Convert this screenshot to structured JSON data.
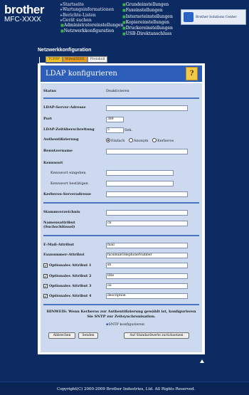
{
  "brand": "brother",
  "model": "MFC-XXXX",
  "nav": {
    "col1": [
      "Startseite",
      "Wartungsinformationen",
      "Berichte-Listen",
      "Gerät suchen",
      "Administratoreinstellungen",
      "Netzwerkkonfiguration"
    ],
    "col2": [
      "Grundeinstellungen",
      "Faxeinstellungen",
      "Interneteinstellungen",
      "Kopiereinstellungen",
      "Druckereinstellungen",
      "USB-Direktanschluss"
    ]
  },
  "solutions_label": "Brother Solutions Center",
  "section_title": "Netzwerkkonfiguration",
  "tabs": [
    "TCP/IP",
    "Wired/IEEE",
    "Protokoll"
  ],
  "panel_title": "LDAP konfigurieren",
  "help_icon": "?",
  "status": {
    "label": "Status",
    "value": "Deaktivieren"
  },
  "fields": {
    "server": {
      "label": "LDAP-Server-Adresse",
      "value": ""
    },
    "port": {
      "label": "Port",
      "value": "389"
    },
    "timeout": {
      "label": "LDAP-Zeitüberschreitung",
      "value": "5",
      "unit": "Sek."
    },
    "auth": {
      "label": "Authentifizierung",
      "options": [
        "Einfach",
        "Anonym",
        "Kerberos"
      ],
      "selected": "Einfach"
    },
    "username": {
      "label": "Benutzername",
      "value": ""
    },
    "password": {
      "label": "Kennwort"
    },
    "password_enter": {
      "label": "Kennwort eingeben",
      "value": ""
    },
    "password_confirm": {
      "label": "Kennwort bestätigen",
      "value": ""
    },
    "kerberos": {
      "label": "Kerberos-Serveradresse",
      "value": ""
    },
    "root_dir": {
      "label": "Stammverzeichnis",
      "value": ""
    },
    "name_attr": {
      "label": "Namensattribut",
      "label2": "(Suchschlüssel)",
      "value": "cn"
    },
    "email_attr": {
      "label": "E-Mail-Attribut",
      "value": "mail"
    },
    "fax_attr": {
      "label": "Faxnummer-Attribut",
      "value": "facsimileTelephoneNumber"
    },
    "opt1": {
      "label": "Optionales Attribut 1",
      "value": "sn",
      "checked": true
    },
    "opt2": {
      "label": "Optionales Attribut 2",
      "value": "title",
      "checked": true
    },
    "opt3": {
      "label": "Optionales Attribut 3",
      "value": "ou",
      "checked": true
    },
    "opt4": {
      "label": "Optionales Attribut 4",
      "value": "description",
      "checked": true
    }
  },
  "note": "HINWEIS: Wenn Kerberos zur Authentifizierung gewählt ist, konfigurieren Sie SNTP zur Zeitsynchronisation.",
  "sntp_link": "SNTP konfigurieren",
  "buttons": {
    "cancel": "Abbrechen",
    "submit": "Senden",
    "reset": "Auf Standardwerte zurücksetzen"
  },
  "footer": "Copyright(C) 2000-2009 Brother Industries, Ltd. All Rights Reserved.",
  "colors": {
    "background": "#0c2b63",
    "panel_title": "#2c5db8",
    "form_area": "#ccd9ef"
  }
}
